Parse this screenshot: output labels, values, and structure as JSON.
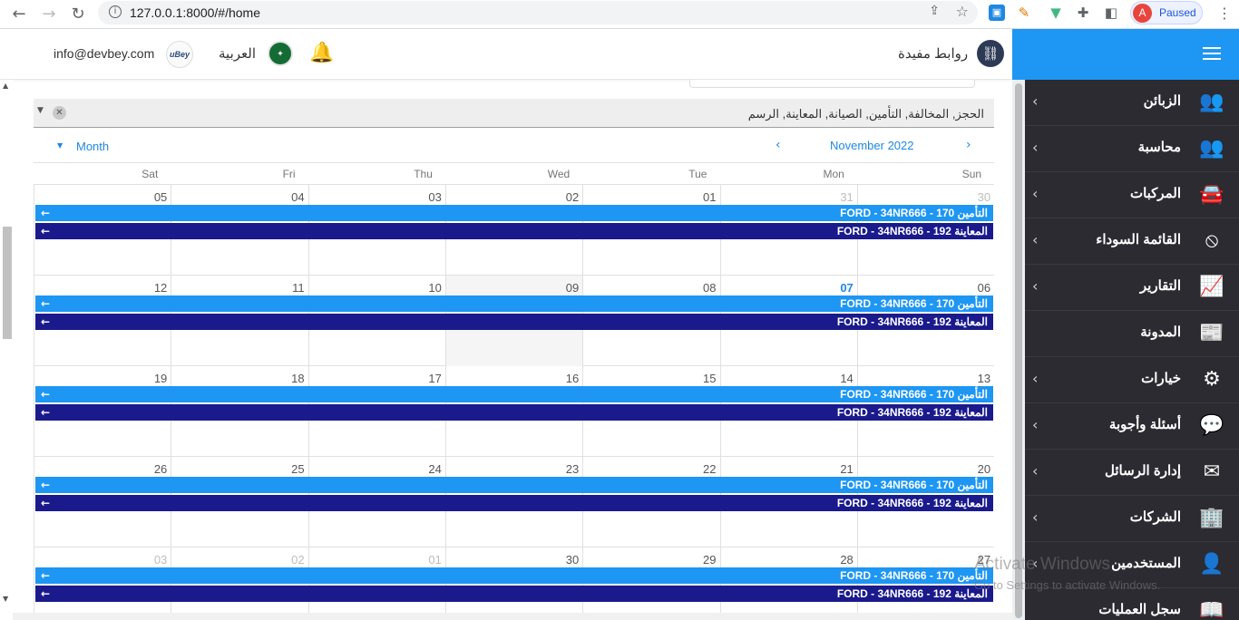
{
  "browser": {
    "url": "127.0.0.1:8000/#/home",
    "profile_initial": "A",
    "profile_status": "Paused"
  },
  "header": {
    "email": "info@devbey.com",
    "logo_text": "uBey",
    "language": "العربية",
    "links_label": "روابط مفيدة"
  },
  "sidebar": {
    "items": [
      {
        "label": "الزبائن",
        "icon": "users-icon",
        "has_children": true
      },
      {
        "label": "محاسبة",
        "icon": "users-icon",
        "has_children": true
      },
      {
        "label": "المركبات",
        "icon": "car-icon",
        "has_children": true
      },
      {
        "label": "القائمة السوداء",
        "icon": "ban-icon",
        "has_children": true
      },
      {
        "label": "التقارير",
        "icon": "chart-line-icon",
        "has_children": true
      },
      {
        "label": "المدونة",
        "icon": "newspaper-icon",
        "has_children": false
      },
      {
        "label": "خيارات",
        "icon": "cogs-icon",
        "has_children": true
      },
      {
        "label": "أسئلة وأجوبة",
        "icon": "comments-icon",
        "has_children": true
      },
      {
        "label": "إدارة الرسائل",
        "icon": "sms-icon",
        "has_children": true
      },
      {
        "label": "الشركات",
        "icon": "building-icon",
        "has_children": true
      },
      {
        "label": "المستخدمين",
        "icon": "user-cog-icon",
        "has_children": true
      },
      {
        "label": "سجل العمليات",
        "icon": "book-icon",
        "has_children": false
      }
    ]
  },
  "filter": {
    "value": "الحجز, المخالفة, التأمين, الصيانة, المعاينة, الرسم"
  },
  "calendar": {
    "view_label": "Month",
    "month_label": "November 2022",
    "day_names": [
      "Sat",
      "Fri",
      "Thu",
      "Wed",
      "Tue",
      "Mon",
      "Sun"
    ],
    "weeks": [
      {
        "days": [
          "05",
          "04",
          "03",
          "02",
          "01",
          "31",
          "30"
        ]
      },
      {
        "days": [
          "12",
          "11",
          "10",
          "09",
          "08",
          "07",
          "06"
        ]
      },
      {
        "days": [
          "19",
          "18",
          "17",
          "16",
          "15",
          "14",
          "13"
        ]
      },
      {
        "days": [
          "26",
          "25",
          "24",
          "23",
          "22",
          "21",
          "20"
        ]
      },
      {
        "days": [
          "03",
          "02",
          "01",
          "30",
          "29",
          "28",
          "27"
        ]
      }
    ],
    "events": [
      {
        "text": "التأمين 170 - FORD - 34NR666",
        "color": "#1e96f3"
      },
      {
        "text": "المعاينة 192 - FORD - 34NR666",
        "color": "#1a1a8c"
      }
    ]
  },
  "watermark": {
    "line1": "Activate Windows",
    "line2": "Go to Settings to activate Windows."
  }
}
